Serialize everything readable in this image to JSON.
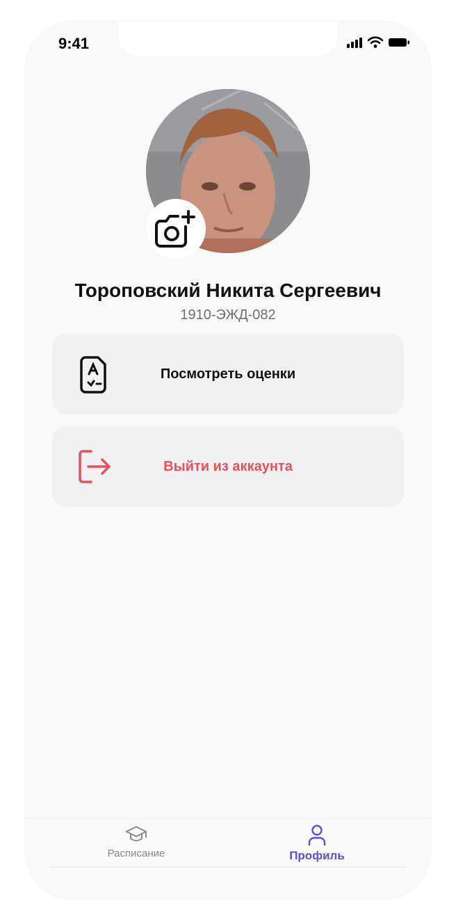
{
  "status_bar": {
    "time": "9:41"
  },
  "profile": {
    "name": "Тороповский Никита Сергеевич",
    "group": "1910-ЭЖД-082"
  },
  "actions": {
    "grades_label": "Посмотреть оценки",
    "logout_label": "Выйти из аккаунта"
  },
  "tabbar": {
    "schedule_label": "Расписание",
    "profile_label": "Профиль"
  },
  "colors": {
    "accent": "#5b4fe0",
    "danger": "#e8505b",
    "card_bg": "#f1f1f1",
    "background": "#f9f9f9"
  },
  "icons": {
    "camera": "camera-plus-icon",
    "grades": "grade-document-icon",
    "logout": "logout-arrow-icon",
    "schedule": "graduation-cap-icon",
    "profile": "user-icon"
  }
}
